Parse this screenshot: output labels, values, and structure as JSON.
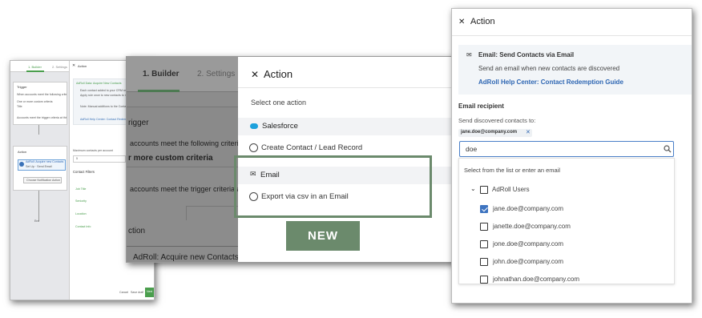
{
  "p1": {
    "tabs": [
      "1. Builder",
      "2. Settings"
    ],
    "canvas": {
      "trigger_title": "Trigger",
      "trigger_desc": "When accounts meet the following criteria",
      "trigger_sub": "One or more custom criteria",
      "trigger_val": "Title",
      "trigger_link": "Accounts meet the trigger criteria at this time",
      "action_title": "Action",
      "action_item": "AdRoll: Acquire new Contacts",
      "action_sub": "Set Up  ·  Send Email",
      "action_btn": "Choose Notification Action",
      "end_label": "End"
    },
    "form": {
      "title": "Action",
      "section": "AdRoll Data: Acquire New Contacts",
      "para1": "Each contact added to your CRM receives an email.",
      "para2": "Apply rule once to new contacts to match",
      "para3": "Note: Manual additions to the Contacts list",
      "link": "AdRoll Help Center: Contact Redemption Guide",
      "max_label": "Maximum contacts per account",
      "max_val": "5",
      "filters_label": "Contact Filters",
      "filters": [
        "Job Title",
        "Seniority",
        "Location",
        "Contact Info"
      ],
      "cancel": "Cancel",
      "save_draft": "Save draft",
      "next": "Next"
    }
  },
  "p2": {
    "tabs": [
      "1. Builder",
      "2. Settings"
    ],
    "left": {
      "trigger": "rigger",
      "criteria": "accounts meet the following criteria:",
      "custom": "r more custom criteria",
      "meet": "accounts meet the trigger criteria at this t",
      "action": "ction",
      "acquire": "AdRoll: Acquire new Contacts"
    },
    "right": {
      "title": "Action",
      "subtitle": "Select one action",
      "salesforce": "Salesforce",
      "create": "Create Contact / Lead Record",
      "email": "Email",
      "export": "Export via csv in an Email"
    },
    "badge": "NEW"
  },
  "p3": {
    "title": "Action",
    "info_title": "Email: Send Contacts via Email",
    "info_desc": "Send an email when new contacts are discovered",
    "info_link": "AdRoll Help Center: Contact Redemption Guide",
    "recipient_label": "Email recipient",
    "send_label": "Send discovered contacts to:",
    "chip": "jane.doe@company.com",
    "search_value": "doe",
    "dropdown_hint": "Select from the list or enter an email",
    "group": "AdRoll Users",
    "options": [
      {
        "email": "jane.doe@company.com",
        "checked": true
      },
      {
        "email": "janette.doe@company.com",
        "checked": false
      },
      {
        "email": "jone.doe@company.com",
        "checked": false
      },
      {
        "email": "john.doe@company.com",
        "checked": false
      },
      {
        "email": "johnathan.doe@company.com",
        "checked": false
      }
    ]
  },
  "colors": {
    "accent_green": "#6b8a6c",
    "link_blue": "#2f67b3",
    "salesforce_blue": "#1da1dc",
    "check_blue": "#3e74c0"
  }
}
